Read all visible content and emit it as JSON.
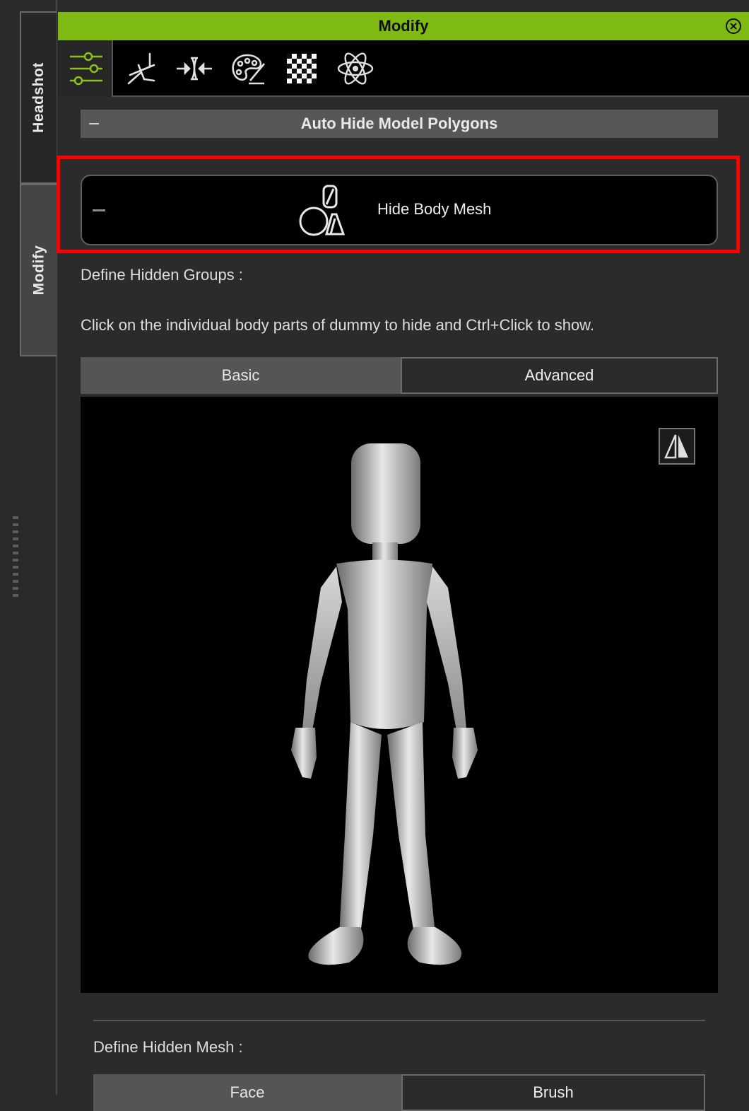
{
  "side_tabs": [
    "Headshot",
    "Modify"
  ],
  "panel": {
    "title": "Modify",
    "accent_color": "#7fba12",
    "highlight_color": "#ff0000"
  },
  "toolbar": {
    "icons": [
      "sliders-icon",
      "motion-pose-icon",
      "compress-icon",
      "palette-icon",
      "checker-texture-icon",
      "atom-physics-icon"
    ],
    "active": "sliders-icon"
  },
  "section": {
    "title": "Auto Hide Model Polygons"
  },
  "hide_body_mesh": {
    "label": "Hide Body Mesh"
  },
  "groups": {
    "label": "Define Hidden Groups :",
    "instructions": "Click on the individual body parts of dummy to hide and Ctrl+Click to show.",
    "tabs": [
      "Basic",
      "Advanced"
    ],
    "active_tab": "Basic"
  },
  "mesh": {
    "label": "Define Hidden Mesh :",
    "tabs": [
      "Face",
      "Brush"
    ],
    "active_tab": "Face"
  }
}
